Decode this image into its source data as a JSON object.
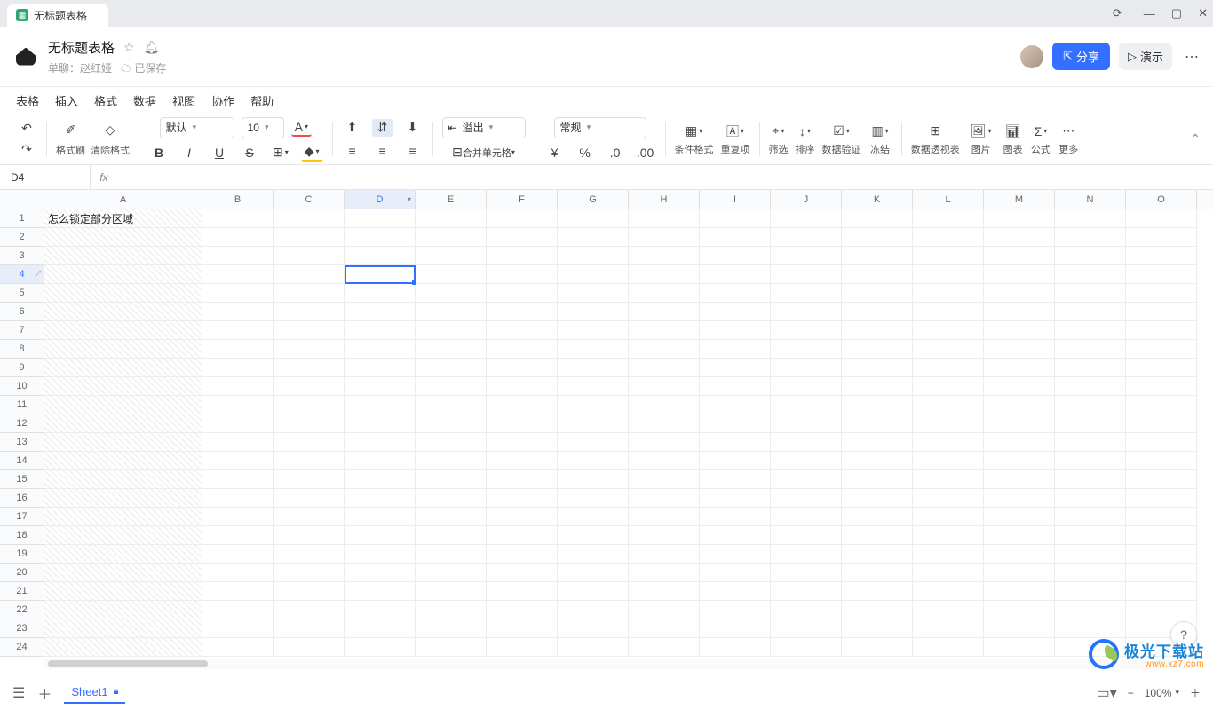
{
  "tab": {
    "title": "无标题表格"
  },
  "header": {
    "title": "无标题表格",
    "owner_label": "单聊：",
    "owner_name": "赵红娅",
    "saved_label": "已保存",
    "share_label": "分享",
    "present_label": "演示"
  },
  "menu": {
    "items": [
      "表格",
      "插入",
      "格式",
      "数据",
      "视图",
      "协作",
      "帮助"
    ]
  },
  "toolbar": {
    "font_family": "默认",
    "font_size": "10",
    "overflow_label": "溢出",
    "merge_label": "合并单元格",
    "number_format": "常规",
    "paint_label": "格式刷",
    "clear_label": "清除格式",
    "cond_label": "条件格式",
    "dup_label": "重复项",
    "filter_label": "筛选",
    "sort_label": "排序",
    "valid_label": "数据验证",
    "freeze_label": "冻结",
    "pivot_label": "数据透视表",
    "image_label": "图片",
    "chart_label": "图表",
    "formula_label": "公式",
    "more_label": "更多"
  },
  "fbar": {
    "cell_ref": "D4",
    "fx": "fx"
  },
  "columns": [
    "A",
    "B",
    "C",
    "D",
    "E",
    "F",
    "G",
    "H",
    "I",
    "J",
    "K",
    "L",
    "M",
    "N",
    "O"
  ],
  "rows": [
    1,
    2,
    3,
    4,
    5,
    6,
    7,
    8,
    9,
    10,
    11,
    12,
    13,
    14,
    15,
    16,
    17,
    18,
    19,
    20,
    21,
    22,
    23,
    24
  ],
  "active": {
    "col": "D",
    "row": 4
  },
  "cells": {
    "A1": "怎么锁定部分区域"
  },
  "sheet": {
    "name": "Sheet1"
  },
  "status": {
    "zoom": "100%"
  },
  "watermark": {
    "brand": "极光下载站",
    "url": "www.xz7.com"
  }
}
